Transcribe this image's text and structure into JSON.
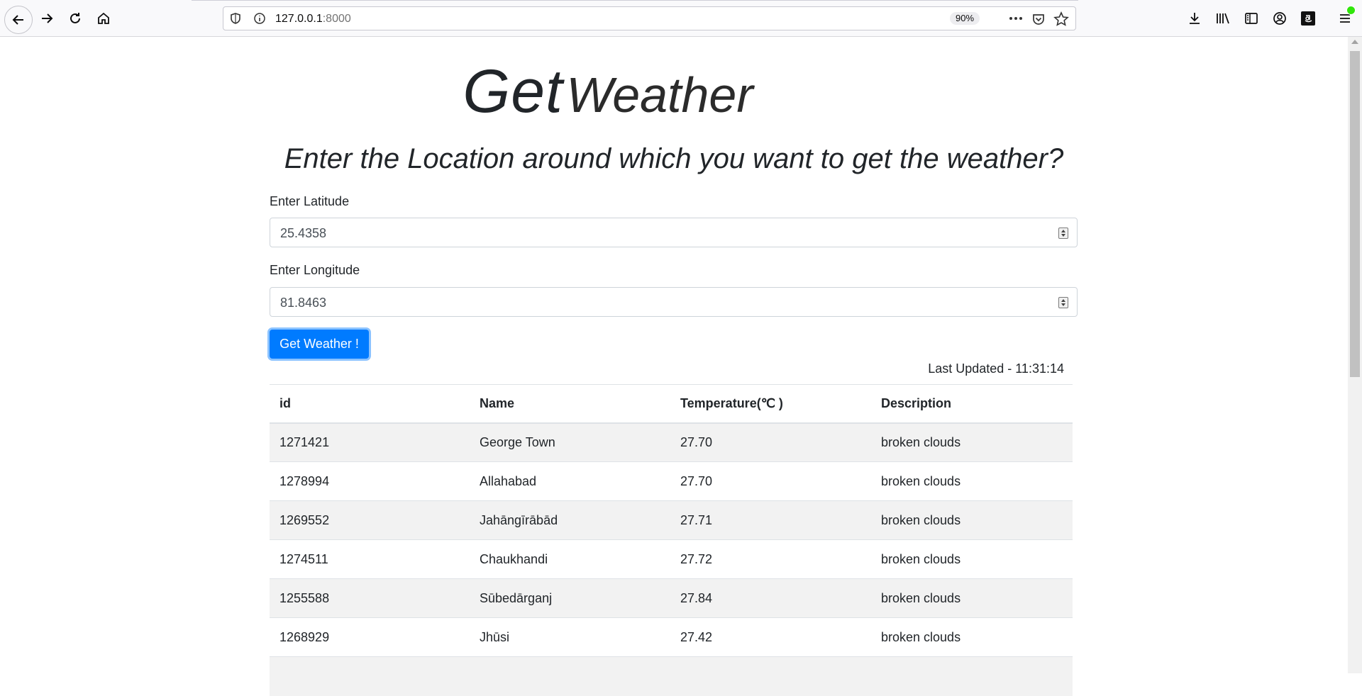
{
  "browser": {
    "url_host": "127.0.0.1",
    "url_port": ":8000",
    "zoom": "90%",
    "icons": [
      "back-icon",
      "forward-icon",
      "reload-icon",
      "home-icon",
      "shield-icon",
      "info-icon",
      "more-icon",
      "pocket-icon",
      "bookmark-star-icon",
      "download-icon",
      "library-icon",
      "sidebar-icon",
      "account-icon",
      "amazon-icon",
      "menu-icon"
    ]
  },
  "page": {
    "title_strong": "Get",
    "title_light": "Weather",
    "subtitle": "Enter the Location around which you want to get the weather?",
    "latitude_label": "Enter Latitude",
    "latitude_value": "25.4358",
    "longitude_label": "Enter Longitude",
    "longitude_value": "81.8463",
    "submit_label": "Get Weather !",
    "last_updated": "Last Updated - 11:31:14"
  },
  "table": {
    "headers": [
      "id",
      "Name",
      "Temperature(℃ )",
      "Description"
    ],
    "rows": [
      [
        "1271421",
        "George Town",
        "27.70",
        "broken clouds"
      ],
      [
        "1278994",
        "Allahabad",
        "27.70",
        "broken clouds"
      ],
      [
        "1269552",
        "Jahāngīrābād",
        "27.71",
        "broken clouds"
      ],
      [
        "1274511",
        "Chaukhandi",
        "27.72",
        "broken clouds"
      ],
      [
        "1255588",
        "Sūbedārganj",
        "27.84",
        "broken clouds"
      ],
      [
        "1268929",
        "Jhūsi",
        "27.42",
        "broken clouds"
      ]
    ]
  },
  "colors": {
    "primary": "#007bff",
    "stripe": "#f2f2f2"
  }
}
